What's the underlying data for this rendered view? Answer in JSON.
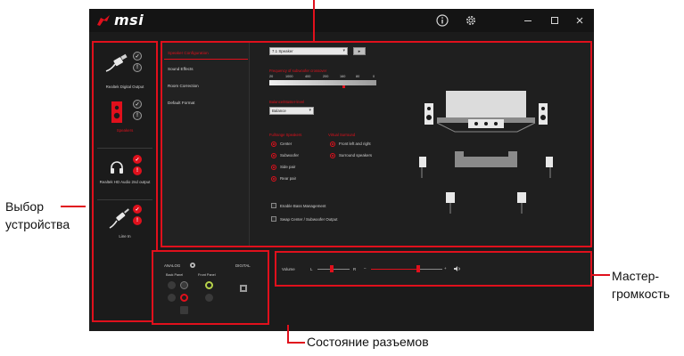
{
  "app": {
    "logo_text": "msi",
    "titlebar_icons": [
      "info-icon",
      "settings-icon",
      "minimize-icon",
      "maximize-icon",
      "close-icon"
    ]
  },
  "devices": [
    {
      "name": "Realtek Digital Output",
      "icon": "spdif-cable-icon",
      "active": false,
      "badges": [
        "ok",
        "info"
      ]
    },
    {
      "name": "Speakers",
      "icon": "speaker-icon",
      "active": true,
      "badges": [
        "ok",
        "info"
      ]
    },
    {
      "name": "Realtek HD Audio 2nd output",
      "icon": "headphones-icon",
      "active": false,
      "badges": [
        "warn",
        "warn"
      ]
    },
    {
      "name": "Line In",
      "icon": "line-in-cable-icon",
      "active": false,
      "badges": [
        "warn",
        "warn"
      ]
    }
  ],
  "tabs": [
    {
      "label": "Speaker Configuration",
      "active": true
    },
    {
      "label": "Sound Effects",
      "active": false
    },
    {
      "label": "Room Correction",
      "active": false
    },
    {
      "label": "Default Format",
      "active": false
    }
  ],
  "speaker_config": {
    "config_select": "7.1 Speaker",
    "play_button": "▸",
    "crossover_label": "Frequency of subwoofer crossover",
    "frequencies": [
      "20",
      "1000",
      "400",
      "200",
      "160",
      "80",
      "0"
    ],
    "balance_label": "Balance/Master-level",
    "balance_select": "Balance",
    "fullrange_label": "Fullrange Speakers",
    "fullrange_options": [
      {
        "label": "Center",
        "selected": true
      },
      {
        "label": "Subwoofer",
        "selected": true
      },
      {
        "label": "Side pair",
        "selected": true
      },
      {
        "label": "Rear pair",
        "selected": true
      }
    ],
    "virtual_label": "Virtual Surround",
    "virtual_options": [
      {
        "label": "Front left and right",
        "selected": true
      },
      {
        "label": "Surround speakers",
        "selected": true
      }
    ],
    "checkboxes": [
      "Enable Bass Management",
      "Swap Center / Subwoofer Output"
    ]
  },
  "jack_status": {
    "analog_label": "ANALOG",
    "digital_label": "DIGITAL",
    "back_panel_label": "Back Panel",
    "front_panel_label": "Front Panel",
    "jack_colors": {
      "green": "#b6d24a",
      "red": "#e0101c",
      "dark": "#3a3a3a"
    }
  },
  "volume": {
    "label": "Volume",
    "left": "L",
    "right": "R",
    "level": 0.66
  },
  "callouts": {
    "device_select": "Выбор\nустройства",
    "master_volume": "Мастер-\nгромкость",
    "jack_status": "Состояние разъемов"
  },
  "colors": {
    "accent": "#e0101c",
    "panel_bg": "#1f1f1f",
    "app_bg": "#1b1b1b"
  }
}
